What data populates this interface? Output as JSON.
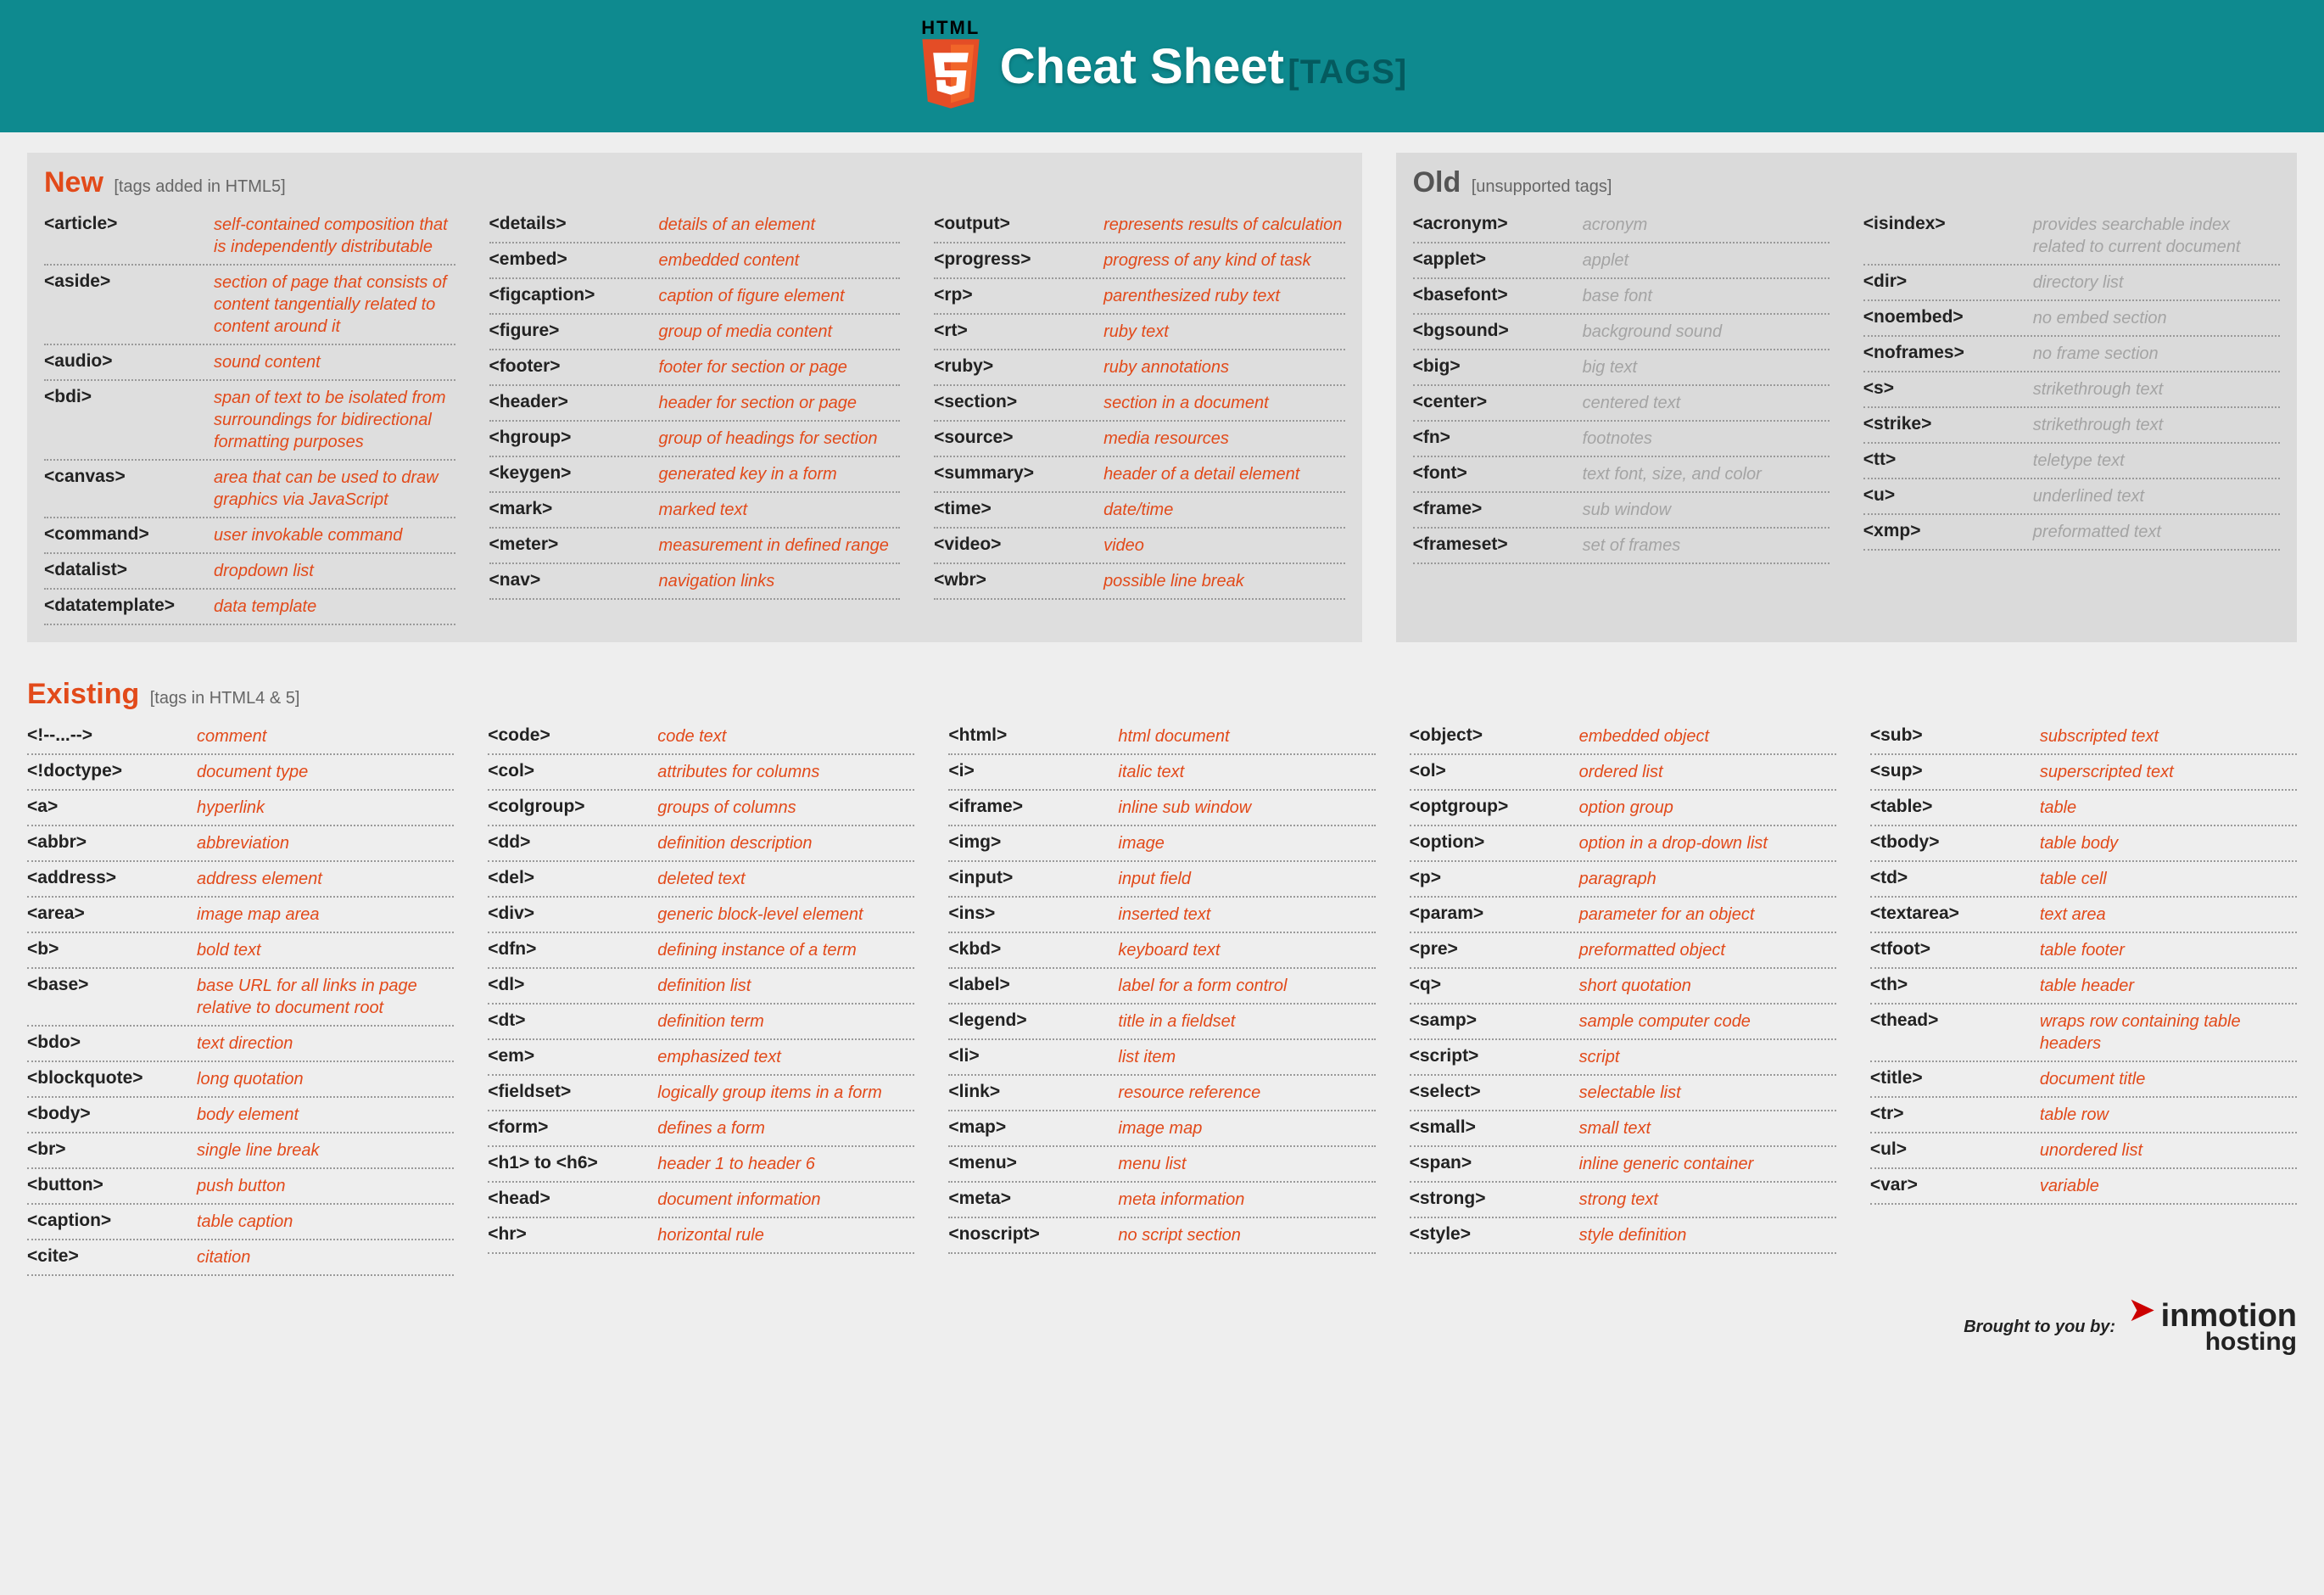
{
  "header": {
    "logo_text": "HTML",
    "title": "Cheat Sheet",
    "subtitle": "[TAGS]"
  },
  "sections": {
    "new": {
      "title": "New",
      "note": "[tags added in HTML5]",
      "cols": [
        [
          {
            "tag": "<article>",
            "desc": "self-contained composition that is independently distributable"
          },
          {
            "tag": "<aside>",
            "desc": "section of page that consists of content tangentially related to content around it"
          },
          {
            "tag": "<audio>",
            "desc": "sound content"
          },
          {
            "tag": "<bdi>",
            "desc": "span of text to be isolated from surroundings for bidirectional formatting purposes"
          },
          {
            "tag": "<canvas>",
            "desc": "area that can be used to draw graphics via JavaScript"
          },
          {
            "tag": "<command>",
            "desc": "user invokable command"
          },
          {
            "tag": "<datalist>",
            "desc": "dropdown list"
          },
          {
            "tag": "<datatemplate>",
            "desc": "data template"
          }
        ],
        [
          {
            "tag": "<details>",
            "desc": "details of an element"
          },
          {
            "tag": "<embed>",
            "desc": "embedded content"
          },
          {
            "tag": "<figcaption>",
            "desc": "caption of figure element"
          },
          {
            "tag": "<figure>",
            "desc": "group of media content"
          },
          {
            "tag": "<footer>",
            "desc": "footer for section or page"
          },
          {
            "tag": "<header>",
            "desc": "header for section or page"
          },
          {
            "tag": "<hgroup>",
            "desc": "group of headings for section"
          },
          {
            "tag": "<keygen>",
            "desc": "generated key in a form"
          },
          {
            "tag": "<mark>",
            "desc": "marked text"
          },
          {
            "tag": "<meter>",
            "desc": "measurement in defined range"
          },
          {
            "tag": "<nav>",
            "desc": "navigation links"
          }
        ],
        [
          {
            "tag": "<output>",
            "desc": "represents results of calculation"
          },
          {
            "tag": "<progress>",
            "desc": "progress of any kind of task"
          },
          {
            "tag": "<rp>",
            "desc": "parenthesized ruby text"
          },
          {
            "tag": "<rt>",
            "desc": "ruby text"
          },
          {
            "tag": "<ruby>",
            "desc": "ruby annotations"
          },
          {
            "tag": "<section>",
            "desc": "section in a document"
          },
          {
            "tag": "<source>",
            "desc": "media resources"
          },
          {
            "tag": "<summary>",
            "desc": "header of a detail element"
          },
          {
            "tag": "<time>",
            "desc": "date/time"
          },
          {
            "tag": "<video>",
            "desc": "video"
          },
          {
            "tag": "<wbr>",
            "desc": "possible line break"
          }
        ]
      ]
    },
    "old": {
      "title": "Old",
      "note": "[unsupported tags]",
      "cols": [
        [
          {
            "tag": "<acronym>",
            "desc": "acronym"
          },
          {
            "tag": "<applet>",
            "desc": "applet"
          },
          {
            "tag": "<basefont>",
            "desc": "base font"
          },
          {
            "tag": "<bgsound>",
            "desc": "background sound"
          },
          {
            "tag": "<big>",
            "desc": "big text"
          },
          {
            "tag": "<center>",
            "desc": "centered text"
          },
          {
            "tag": "<fn>",
            "desc": "footnotes"
          },
          {
            "tag": "<font>",
            "desc": "text font, size, and color"
          },
          {
            "tag": "<frame>",
            "desc": "sub window"
          },
          {
            "tag": "<frameset>",
            "desc": "set of frames"
          }
        ],
        [
          {
            "tag": "<isindex>",
            "desc": "provides searchable index related to current document"
          },
          {
            "tag": "<dir>",
            "desc": "directory list"
          },
          {
            "tag": "<noembed>",
            "desc": "no embed section"
          },
          {
            "tag": "<noframes>",
            "desc": "no frame section"
          },
          {
            "tag": "<s>",
            "desc": "strikethrough text"
          },
          {
            "tag": "<strike>",
            "desc": "strikethrough text"
          },
          {
            "tag": "<tt>",
            "desc": "teletype text"
          },
          {
            "tag": "<u>",
            "desc": "underlined text"
          },
          {
            "tag": "<xmp>",
            "desc": "preformatted text"
          }
        ]
      ]
    },
    "existing": {
      "title": "Existing",
      "note": "[tags in HTML4 & 5]",
      "cols": [
        [
          {
            "tag": "<!--...-->",
            "desc": "comment"
          },
          {
            "tag": "<!doctype>",
            "desc": "document type"
          },
          {
            "tag": "<a>",
            "desc": "hyperlink"
          },
          {
            "tag": "<abbr>",
            "desc": "abbreviation"
          },
          {
            "tag": "<address>",
            "desc": "address element"
          },
          {
            "tag": "<area>",
            "desc": "image map area"
          },
          {
            "tag": "<b>",
            "desc": "bold text"
          },
          {
            "tag": "<base>",
            "desc": "base URL for all links in page relative to document root"
          },
          {
            "tag": "<bdo>",
            "desc": "text direction"
          },
          {
            "tag": "<blockquote>",
            "desc": "long quotation"
          },
          {
            "tag": "<body>",
            "desc": "body element"
          },
          {
            "tag": "<br>",
            "desc": "single line break"
          },
          {
            "tag": "<button>",
            "desc": "push button"
          },
          {
            "tag": "<caption>",
            "desc": "table caption"
          },
          {
            "tag": "<cite>",
            "desc": "citation"
          }
        ],
        [
          {
            "tag": "<code>",
            "desc": "code text"
          },
          {
            "tag": "<col>",
            "desc": "attributes for columns"
          },
          {
            "tag": "<colgroup>",
            "desc": "groups of columns"
          },
          {
            "tag": "<dd>",
            "desc": "definition description"
          },
          {
            "tag": "<del>",
            "desc": "deleted text"
          },
          {
            "tag": "<div>",
            "desc": "generic block-level element"
          },
          {
            "tag": "<dfn>",
            "desc": "defining instance of a term"
          },
          {
            "tag": "<dl>",
            "desc": "definition list"
          },
          {
            "tag": "<dt>",
            "desc": "definition term"
          },
          {
            "tag": "<em>",
            "desc": "emphasized text"
          },
          {
            "tag": "<fieldset>",
            "desc": "logically group items in a form"
          },
          {
            "tag": "<form>",
            "desc": "defines a form"
          },
          {
            "tag": "<h1> to <h6>",
            "desc": "header 1 to header 6"
          },
          {
            "tag": "<head>",
            "desc": "document information"
          },
          {
            "tag": "<hr>",
            "desc": "horizontal rule"
          }
        ],
        [
          {
            "tag": "<html>",
            "desc": "html document"
          },
          {
            "tag": "<i>",
            "desc": "italic text"
          },
          {
            "tag": "<iframe>",
            "desc": "inline sub window"
          },
          {
            "tag": "<img>",
            "desc": "image"
          },
          {
            "tag": "<input>",
            "desc": "input field"
          },
          {
            "tag": "<ins>",
            "desc": "inserted text"
          },
          {
            "tag": "<kbd>",
            "desc": "keyboard text"
          },
          {
            "tag": "<label>",
            "desc": "label for a form control"
          },
          {
            "tag": "<legend>",
            "desc": "title in a fieldset"
          },
          {
            "tag": "<li>",
            "desc": "list item"
          },
          {
            "tag": "<link>",
            "desc": "resource reference"
          },
          {
            "tag": "<map>",
            "desc": "image map"
          },
          {
            "tag": "<menu>",
            "desc": "menu list"
          },
          {
            "tag": "<meta>",
            "desc": "meta information"
          },
          {
            "tag": "<noscript>",
            "desc": "no script section"
          }
        ],
        [
          {
            "tag": "<object>",
            "desc": "embedded object"
          },
          {
            "tag": "<ol>",
            "desc": "ordered list"
          },
          {
            "tag": "<optgroup>",
            "desc": "option group"
          },
          {
            "tag": "<option>",
            "desc": "option in a drop-down list"
          },
          {
            "tag": "<p>",
            "desc": "paragraph"
          },
          {
            "tag": "<param>",
            "desc": "parameter for an object"
          },
          {
            "tag": "<pre>",
            "desc": "preformatted object"
          },
          {
            "tag": "<q>",
            "desc": "short quotation"
          },
          {
            "tag": "<samp>",
            "desc": "sample computer code"
          },
          {
            "tag": "<script>",
            "desc": "script"
          },
          {
            "tag": "<select>",
            "desc": "selectable list"
          },
          {
            "tag": "<small>",
            "desc": "small text"
          },
          {
            "tag": "<span>",
            "desc": "inline generic container"
          },
          {
            "tag": "<strong>",
            "desc": "strong text"
          },
          {
            "tag": "<style>",
            "desc": "style definition"
          }
        ],
        [
          {
            "tag": "<sub>",
            "desc": "subscripted text"
          },
          {
            "tag": "<sup>",
            "desc": "superscripted text"
          },
          {
            "tag": "<table>",
            "desc": "table"
          },
          {
            "tag": "<tbody>",
            "desc": "table body"
          },
          {
            "tag": "<td>",
            "desc": "table cell"
          },
          {
            "tag": "<textarea>",
            "desc": "text area"
          },
          {
            "tag": "<tfoot>",
            "desc": "table footer"
          },
          {
            "tag": "<th>",
            "desc": "table header"
          },
          {
            "tag": "<thead>",
            "desc": "wraps row containing table headers"
          },
          {
            "tag": "<title>",
            "desc": "document title"
          },
          {
            "tag": "<tr>",
            "desc": "table row"
          },
          {
            "tag": "<ul>",
            "desc": "unordered list"
          },
          {
            "tag": "<var>",
            "desc": "variable"
          }
        ]
      ]
    }
  },
  "footer": {
    "brought": "Brought to you by:",
    "brand1": "inmotion",
    "brand2": "hosting"
  }
}
